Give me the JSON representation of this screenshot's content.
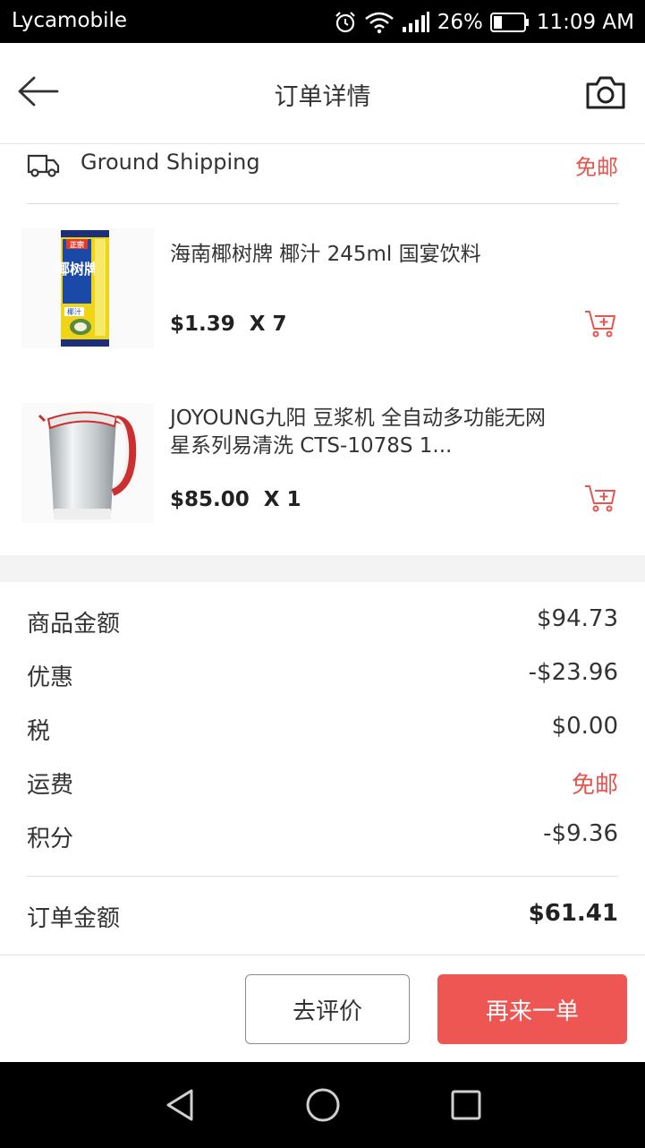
{
  "status_bar": {
    "carrier": "Lycamobile",
    "battery_percent": "26%",
    "time": "11:09 AM"
  },
  "header": {
    "title": "订单详情"
  },
  "shipping": {
    "method": "Ground Shipping",
    "fee": "免邮"
  },
  "products": [
    {
      "name": "海南椰树牌 椰汁 245ml 国宴饮料",
      "price": "$1.39",
      "quantity": "X 7",
      "image": "coconut-juice-carton",
      "image_text": [
        "正宗",
        "椰树牌",
        "椰汁"
      ]
    },
    {
      "name": "JOYOUNG九阳 豆浆机 全自动多功能无网星系列易清洗 CTS-1078S 1...",
      "price": "$85.00",
      "quantity": "X 1",
      "image": "soymilk-maker"
    }
  ],
  "summary": {
    "rows": [
      {
        "label": "商品金额",
        "value": "$94.73"
      },
      {
        "label": "优惠",
        "value": "-$23.96"
      },
      {
        "label": "税",
        "value": "$0.00"
      },
      {
        "label": "运费",
        "value": "免邮"
      },
      {
        "label": "积分",
        "value": "-$9.36"
      }
    ],
    "total_label": "订单金额",
    "total_value": "$61.41"
  },
  "actions": {
    "review_label": "去评价",
    "reorder_label": "再来一单"
  },
  "colors": {
    "accent": "#ee5654",
    "free_text": "#e8544e"
  }
}
